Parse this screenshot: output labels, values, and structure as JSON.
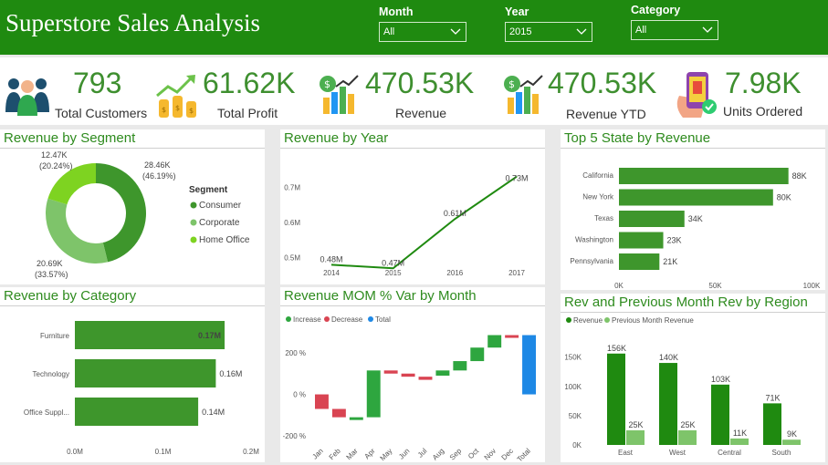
{
  "header": {
    "title": "Superstore Sales Analysis",
    "slicers": [
      {
        "label": "Month",
        "value": "All"
      },
      {
        "label": "Year",
        "value": "2015"
      },
      {
        "label": "Category",
        "value": "All"
      }
    ]
  },
  "kpis": [
    {
      "value": "793",
      "caption": "Total Customers",
      "icon": "customers-icon"
    },
    {
      "value": "61.62K",
      "caption": "Total Profit",
      "icon": "profit-icon"
    },
    {
      "value": "470.53K",
      "caption": "Revenue",
      "icon": "revenue-icon"
    },
    {
      "value": "470.53K",
      "caption": "Revenue YTD",
      "icon": "revenue-ytd-icon"
    },
    {
      "value": "7.98K",
      "caption": "Units Ordered",
      "icon": "units-ordered-icon"
    }
  ],
  "colors": {
    "brand": "#1f8a10",
    "bar": "#3e962c",
    "light_green": "#7ec46a",
    "lime": "#7ed321",
    "increase": "#2ea63f",
    "decrease": "#d94452",
    "total": "#1e88e5"
  },
  "chart_data": [
    {
      "id": "segment",
      "type": "pie",
      "title": "Revenue by Segment",
      "legend_title": "Segment",
      "slices": [
        {
          "name": "Consumer",
          "value": 28.46,
          "label": "28.46K",
          "pct": "(46.19%)",
          "color": "#3e962c"
        },
        {
          "name": "Corporate",
          "value": 20.69,
          "label": "20.69K",
          "pct": "(33.57%)",
          "color": "#7ec46a"
        },
        {
          "name": "Home Office",
          "value": 12.47,
          "label": "12.47K",
          "pct": "(20.24%)",
          "color": "#7ed321"
        }
      ]
    },
    {
      "id": "year",
      "type": "line",
      "title": "Revenue by Year",
      "x": [
        "2014",
        "2015",
        "2016",
        "2017"
      ],
      "values": [
        0.48,
        0.47,
        0.61,
        0.73
      ],
      "labels": [
        "0.48M",
        "0.47M",
        "0.61M",
        "0.73M"
      ],
      "ylim": [
        0.45,
        0.75
      ],
      "yticks": [
        {
          "v": 0.5,
          "label": "0.5M"
        },
        {
          "v": 0.6,
          "label": "0.6M"
        },
        {
          "v": 0.7,
          "label": "0.7M"
        }
      ]
    },
    {
      "id": "state",
      "type": "bar",
      "title": "Top 5 State by Revenue",
      "categories": [
        "California",
        "New York",
        "Texas",
        "Washington",
        "Pennsylvania"
      ],
      "values": [
        88,
        80,
        34,
        23,
        21
      ],
      "labels": [
        "88K",
        "80K",
        "34K",
        "23K",
        "21K"
      ],
      "xlim": [
        0,
        100
      ],
      "xticks": [
        {
          "v": 0,
          "label": "0K"
        },
        {
          "v": 50,
          "label": "50K"
        },
        {
          "v": 100,
          "label": "100K"
        }
      ]
    },
    {
      "id": "category",
      "type": "bar",
      "title": "Revenue by Category",
      "categories": [
        "Furniture",
        "Technology",
        "Office Suppl..."
      ],
      "values": [
        0.17,
        0.16,
        0.14
      ],
      "labels": [
        "0.17M",
        "0.16M",
        "0.14M"
      ],
      "xlim": [
        0,
        0.2
      ],
      "xticks": [
        {
          "v": 0,
          "label": "0.0M"
        },
        {
          "v": 0.1,
          "label": "0.1M"
        },
        {
          "v": 0.2,
          "label": "0.2M"
        }
      ]
    },
    {
      "id": "mom",
      "type": "bar",
      "title": "Revenue MOM % Var by Month",
      "legend": [
        "Increase",
        "Decrease",
        "Total"
      ],
      "categories": [
        "Jan",
        "Feb",
        "Mar",
        "Apr",
        "May",
        "Jun",
        "Jul",
        "Aug",
        "Sep",
        "Oct",
        "Nov",
        "Dec",
        "Total"
      ],
      "start": [
        0,
        -70,
        -110,
        -110,
        115,
        100,
        85,
        90,
        115,
        160,
        225,
        285,
        285
      ],
      "end": [
        -70,
        -110,
        -110,
        115,
        100,
        85,
        70,
        115,
        160,
        225,
        285,
        280,
        0
      ],
      "kind": [
        "decrease",
        "decrease",
        "increase",
        "increase",
        "decrease",
        "decrease",
        "decrease",
        "increase",
        "increase",
        "increase",
        "increase",
        "decrease",
        "total"
      ],
      "ylim": [
        -230,
        340
      ],
      "yticks": [
        {
          "v": 200,
          "label": "200 %"
        },
        {
          "v": 0,
          "label": "0 %"
        },
        {
          "v": -200,
          "label": "-200 %"
        }
      ]
    },
    {
      "id": "region",
      "type": "bar",
      "title": "Rev and Previous Month Rev by Region",
      "legend": [
        "Revenue",
        "Previous Month Revenue"
      ],
      "categories": [
        "East",
        "West",
        "Central",
        "South"
      ],
      "series": [
        {
          "name": "Revenue",
          "values": [
            156,
            140,
            103,
            71
          ],
          "labels": [
            "156K",
            "140K",
            "103K",
            "71K"
          ]
        },
        {
          "name": "Previous Month Revenue",
          "values": [
            25,
            25,
            11,
            9
          ],
          "labels": [
            "25K",
            "25K",
            "11K",
            "9K"
          ]
        }
      ],
      "ylim": [
        0,
        165
      ],
      "yticks": [
        {
          "v": 0,
          "label": "0K"
        },
        {
          "v": 50,
          "label": "50K"
        },
        {
          "v": 100,
          "label": "100K"
        },
        {
          "v": 150,
          "label": "150K"
        }
      ]
    }
  ]
}
